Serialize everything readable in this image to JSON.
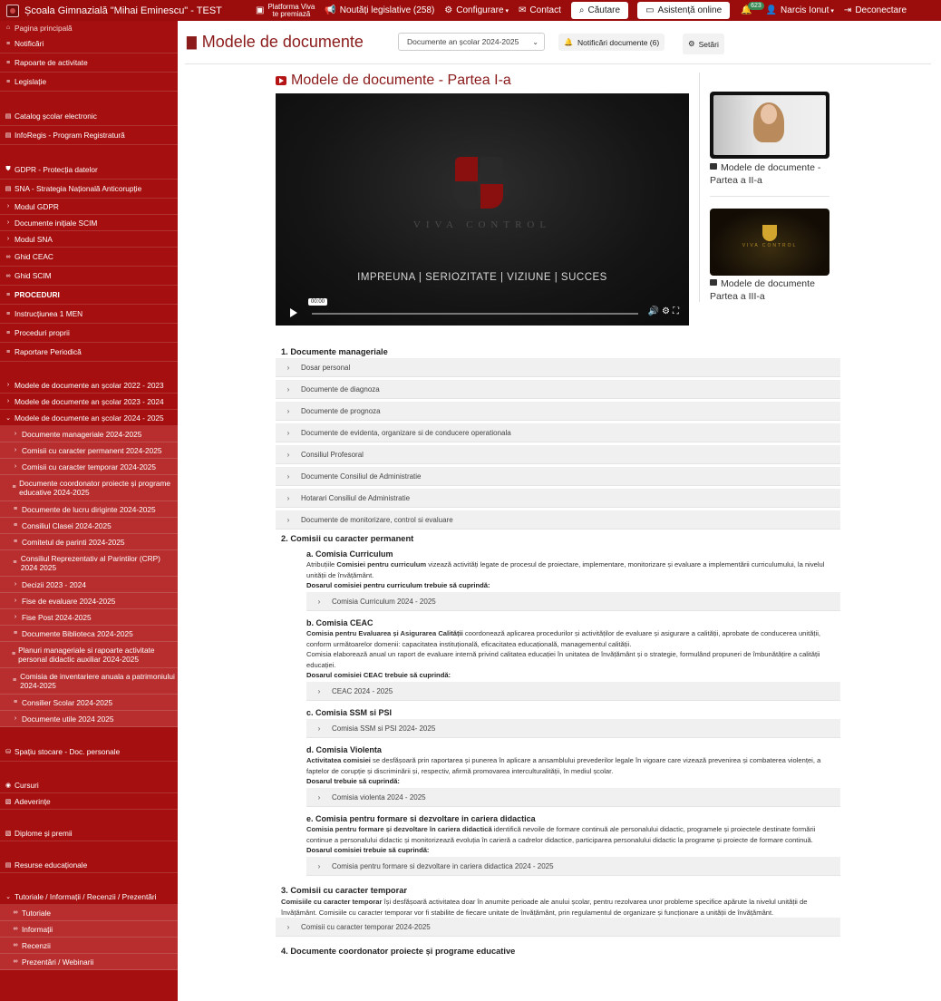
{
  "topbar": {
    "school": "Școala Gimnazială \"Mihai Eminescu\" - TEST",
    "viva_line1": "Platforma Viva",
    "viva_line2": "te premiază",
    "news": "Noutăți legislative (258)",
    "config": "Configurare",
    "contact": "Contact",
    "search": "Căutare",
    "assist": "Asistență online",
    "notif_count": "623",
    "user": "Narcis Ionut",
    "logout": "Deconectare"
  },
  "sidebar": {
    "home": "Pagina principală",
    "items": [
      "Notificări",
      "Rapoarte de activitate",
      "Legislație",
      "Catalog școlar electronic",
      "InfoRegis - Program Registratură",
      "GDPR - Protecția datelor",
      "SNA - Strategia Națională Anticorupție",
      "Modul GDPR",
      "Documente inițiale SCIM",
      "Modul SNA",
      "Ghid CEAC",
      "Ghid SCIM",
      "PROCEDURI",
      "Instrucțiunea 1 MEN",
      "Proceduri proprii",
      "Raportare Periodică",
      "Modele de documente an școlar 2022 - 2023",
      "Modele de documente an școlar 2023 - 2024",
      "Modele de documente an școlar 2024 - 2025"
    ],
    "sub": [
      "Documente manageriale 2024-2025",
      "Comisii cu caracter permanent 2024-2025",
      "Comisii cu caracter temporar 2024-2025",
      "Documente coordonator proiecte și programe educative 2024-2025",
      "Documente de lucru diriginte 2024-2025",
      "Consiliul Clasei 2024-2025",
      "Comitetul de parinti 2024-2025",
      "Consiliul Reprezentativ al Parintilor (CRP) 2024 2025",
      "Decizii 2023 - 2024",
      "Fise de evaluare 2024-2025",
      "Fise Post 2024-2025",
      "Documente Biblioteca 2024-2025",
      "Planuri manageriale si rapoarte activitate personal didactic auxiliar 2024-2025",
      "Comisia de inventariere anuala a patrimoniului 2024-2025",
      "Consilier Scolar 2024-2025",
      "Documente utile 2024 2025"
    ],
    "bottom": [
      "Spațiu stocare - Doc. personale",
      "Cursuri",
      "Adeverințe",
      "Diplome și premii",
      "Resurse educaționale",
      "Tutoriale / Informații / Recenzii / Prezentări"
    ],
    "tut": [
      "Tutoriale",
      "Informații",
      "Recenzii",
      "Prezentări / Webinarii"
    ]
  },
  "page": {
    "title": "Modele de documente",
    "year_select": "Documente an școlar 2024-2025",
    "notif_btn": "Notificări documente (6)",
    "settings": "Setări"
  },
  "video": {
    "title": "Modele de documente - Partea I-a",
    "logo": "VIVA CONTROL",
    "slogan": "IMPREUNA | SERIOZITATE | VIZIUNE | SUCCES",
    "time": "00:00"
  },
  "thumbs": [
    {
      "caption": "Modele de documente - Partea a II-a"
    },
    {
      "caption": "Modele de documente Partea a III-a",
      "logo": "VIVA CONTROL"
    }
  ],
  "sections": {
    "s1": "1. Documente manageriale",
    "s1_items": [
      "Dosar personal",
      "Documente de diagnoza",
      "Documente de prognoza",
      "Documente de evidenta, organizare si de conducere operationala",
      "Consiliul Profesoral",
      "Documente Consiliul de Administratie",
      "Hotarari Consiliul de Administratie",
      "Documente de monitorizare, control si evaluare"
    ],
    "s2": "2. Comisii cu caracter permanent",
    "a_h": "a. Comisia Curriculum",
    "a_b": "Atribuțiile ",
    "a_bb": "Comisiei pentru curriculum",
    "a_t": " vizează activități legate de procesul de proiectare, implementare, monitorizare și evaluare a implementării curriculumului, la nivelul unității de învățământ.",
    "a_d": "Dosarul comisiei pentru curriculum trebuie să cuprindă:",
    "a_acc": "Comisia Curriculum 2024 - 2025",
    "b_h": "b. Comisia CEAC",
    "b_bb": "Comisia pentru Evaluarea și Asigurarea Calității",
    "b_t": " coordonează aplicarea procedurilor și activităților de evaluare și asigurare a calității, aprobate de conducerea unității, conform următoarelor domenii: capacitatea instituțională, eficacitatea educațională, managementul calității.",
    "b_t2": "Comisia elaborează anual un raport de evaluare internă privind calitatea educației în unitatea de învățământ și o strategie, formulând propuneri de îmbunătățire a calității educației.",
    "b_d": "Dosarul comisiei CEAC trebuie să cuprindă:",
    "b_acc": "CEAC 2024 - 2025",
    "c_h": "c. Comisia SSM si PSI",
    "c_acc": "Comisia SSM si PSI 2024- 2025",
    "d_h": "d. Comisia Violenta",
    "d_bb": "Activitatea comisiei",
    "d_t": " se desfășoară prin raportarea și punerea în aplicare a ansamblului prevederilor legale în vigoare care vizează prevenirea și combaterea violenței, a faptelor de corupție și discriminării și, respectiv, afirmă promovarea interculturalității, în mediul școlar.",
    "d_d": "Dosarul trebuie să cuprindă:",
    "d_acc": "Comisia violenta 2024 - 2025",
    "e_h": "e. Comisia pentru formare si dezvoltare in cariera didactica",
    "e_bb": "Comisia pentru formare și dezvoltare în cariera didactică",
    "e_t": " identifică nevoile de formare continuă ale personalului didactic, programele și proiectele destinate formării continue a personalului didactic și monitorizează evoluția în carieră a cadrelor didactice, participarea personalului didactic la programe și proiecte de formare continuă.",
    "e_d": "Dosarul comisiei trebuie să cuprindă:",
    "e_acc": "Comisia pentru formare si dezvoltare in cariera didactica 2024 - 2025",
    "s3": "3. Comisii cu caracter temporar",
    "s3_bb": "Comisiile cu caracter temporar",
    "s3_t": " își desfășoară activitatea doar în anumite perioade ale anului școlar, pentru rezolvarea unor probleme specifice apărute la nivelul unității de învățământ. Comisiile cu caracter temporar vor fi stabilite de fiecare unitate de învățământ, prin regulamentul de organizare și funcționare a unității de învățământ.",
    "s3_acc": "Comisii cu caracter temporar 2024-2025",
    "s4": "4. Documente coordonator proiecte și programe educative"
  }
}
